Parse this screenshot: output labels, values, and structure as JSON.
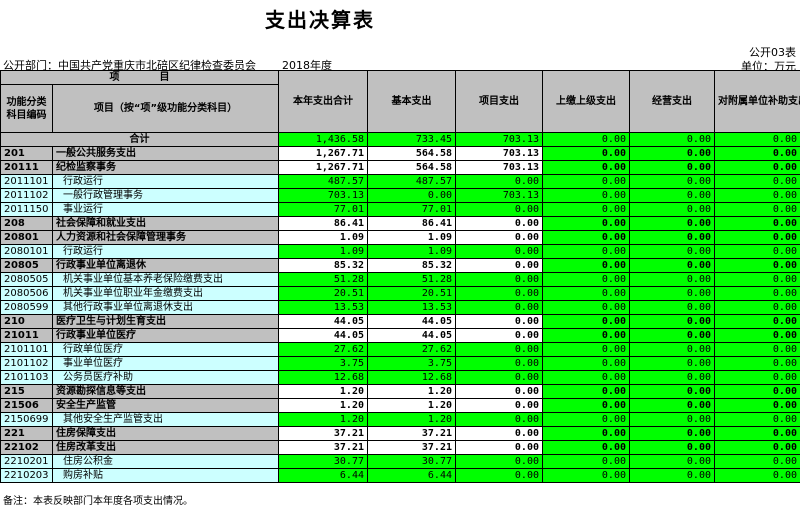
{
  "title": "支出决算表",
  "form_no": "公开03表",
  "unit": "单位：万元",
  "dept_label": "公开部门：中国共产党重庆市北碚区纪律检查委员会",
  "year": "2018年度",
  "headers": {
    "item_group": "项　　　　目",
    "code": "功能分类科目编码",
    "name": "项目（按“项”级功能分类科目）",
    "total": "本年支出合计",
    "basic": "基本支出",
    "project": "项目支出",
    "upper": "上缴上级支出",
    "operate": "经营支出",
    "subsidy": "对附属单位补助支出"
  },
  "total_row": {
    "label": "合计",
    "total": "1,436.58",
    "basic": "733.45",
    "project": "703.13",
    "upper": "0.00",
    "operate": "0.00",
    "subsidy": "0.00"
  },
  "rows": [
    {
      "code": "201",
      "name": "一般公共服务支出",
      "total": "1,267.71",
      "basic": "564.58",
      "project": "703.13",
      "upper": "0.00",
      "operate": "0.00",
      "subsidy": "0.00",
      "level": 1
    },
    {
      "code": "20111",
      "name": "纪检监察事务",
      "total": "1,267.71",
      "basic": "564.58",
      "project": "703.13",
      "upper": "0.00",
      "operate": "0.00",
      "subsidy": "0.00",
      "level": 2
    },
    {
      "code": "2011101",
      "name": "行政运行",
      "total": "487.57",
      "basic": "487.57",
      "project": "0.00",
      "upper": "0.00",
      "operate": "0.00",
      "subsidy": "0.00",
      "level": 3
    },
    {
      "code": "2011102",
      "name": "一般行政管理事务",
      "total": "703.13",
      "basic": "0.00",
      "project": "703.13",
      "upper": "0.00",
      "operate": "0.00",
      "subsidy": "0.00",
      "level": 3
    },
    {
      "code": "2011150",
      "name": "事业运行",
      "total": "77.01",
      "basic": "77.01",
      "project": "0.00",
      "upper": "0.00",
      "operate": "0.00",
      "subsidy": "0.00",
      "level": 3
    },
    {
      "code": "208",
      "name": "社会保障和就业支出",
      "total": "86.41",
      "basic": "86.41",
      "project": "0.00",
      "upper": "0.00",
      "operate": "0.00",
      "subsidy": "0.00",
      "level": 1
    },
    {
      "code": "20801",
      "name": "人力资源和社会保障管理事务",
      "total": "1.09",
      "basic": "1.09",
      "project": "0.00",
      "upper": "0.00",
      "operate": "0.00",
      "subsidy": "0.00",
      "level": 2
    },
    {
      "code": "2080101",
      "name": "行政运行",
      "total": "1.09",
      "basic": "1.09",
      "project": "0.00",
      "upper": "0.00",
      "operate": "0.00",
      "subsidy": "0.00",
      "level": 3
    },
    {
      "code": "20805",
      "name": "行政事业单位离退休",
      "total": "85.32",
      "basic": "85.32",
      "project": "0.00",
      "upper": "0.00",
      "operate": "0.00",
      "subsidy": "0.00",
      "level": 2
    },
    {
      "code": "2080505",
      "name": "机关事业单位基本养老保险缴费支出",
      "total": "51.28",
      "basic": "51.28",
      "project": "0.00",
      "upper": "0.00",
      "operate": "0.00",
      "subsidy": "0.00",
      "level": 3
    },
    {
      "code": "2080506",
      "name": "机关事业单位职业年金缴费支出",
      "total": "20.51",
      "basic": "20.51",
      "project": "0.00",
      "upper": "0.00",
      "operate": "0.00",
      "subsidy": "0.00",
      "level": 3
    },
    {
      "code": "2080599",
      "name": "其他行政事业单位离退休支出",
      "total": "13.53",
      "basic": "13.53",
      "project": "0.00",
      "upper": "0.00",
      "operate": "0.00",
      "subsidy": "0.00",
      "level": 3
    },
    {
      "code": "210",
      "name": "医疗卫生与计划生育支出",
      "total": "44.05",
      "basic": "44.05",
      "project": "0.00",
      "upper": "0.00",
      "operate": "0.00",
      "subsidy": "0.00",
      "level": 1
    },
    {
      "code": "21011",
      "name": "行政事业单位医疗",
      "total": "44.05",
      "basic": "44.05",
      "project": "0.00",
      "upper": "0.00",
      "operate": "0.00",
      "subsidy": "0.00",
      "level": 2
    },
    {
      "code": "2101101",
      "name": "行政单位医疗",
      "total": "27.62",
      "basic": "27.62",
      "project": "0.00",
      "upper": "0.00",
      "operate": "0.00",
      "subsidy": "0.00",
      "level": 3
    },
    {
      "code": "2101102",
      "name": "事业单位医疗",
      "total": "3.75",
      "basic": "3.75",
      "project": "0.00",
      "upper": "0.00",
      "operate": "0.00",
      "subsidy": "0.00",
      "level": 3
    },
    {
      "code": "2101103",
      "name": "公务员医疗补助",
      "total": "12.68",
      "basic": "12.68",
      "project": "0.00",
      "upper": "0.00",
      "operate": "0.00",
      "subsidy": "0.00",
      "level": 3
    },
    {
      "code": "215",
      "name": "资源勘探信息等支出",
      "total": "1.20",
      "basic": "1.20",
      "project": "0.00",
      "upper": "0.00",
      "operate": "0.00",
      "subsidy": "0.00",
      "level": 1
    },
    {
      "code": "21506",
      "name": "安全生产监管",
      "total": "1.20",
      "basic": "1.20",
      "project": "0.00",
      "upper": "0.00",
      "operate": "0.00",
      "subsidy": "0.00",
      "level": 2
    },
    {
      "code": "2150699",
      "name": "其他安全生产监管支出",
      "total": "1.20",
      "basic": "1.20",
      "project": "0.00",
      "upper": "0.00",
      "operate": "0.00",
      "subsidy": "0.00",
      "level": 3
    },
    {
      "code": "221",
      "name": "住房保障支出",
      "total": "37.21",
      "basic": "37.21",
      "project": "0.00",
      "upper": "0.00",
      "operate": "0.00",
      "subsidy": "0.00",
      "level": 1
    },
    {
      "code": "22102",
      "name": "住房改革支出",
      "total": "37.21",
      "basic": "37.21",
      "project": "0.00",
      "upper": "0.00",
      "operate": "0.00",
      "subsidy": "0.00",
      "level": 2
    },
    {
      "code": "2210201",
      "name": "住房公积金",
      "total": "30.77",
      "basic": "30.77",
      "project": "0.00",
      "upper": "0.00",
      "operate": "0.00",
      "subsidy": "0.00",
      "level": 3
    },
    {
      "code": "2210203",
      "name": "购房补贴",
      "total": "6.44",
      "basic": "6.44",
      "project": "0.00",
      "upper": "0.00",
      "operate": "0.00",
      "subsidy": "0.00",
      "level": 3
    }
  ],
  "note": "备注：本表反映部门本年度各项支出情况。"
}
